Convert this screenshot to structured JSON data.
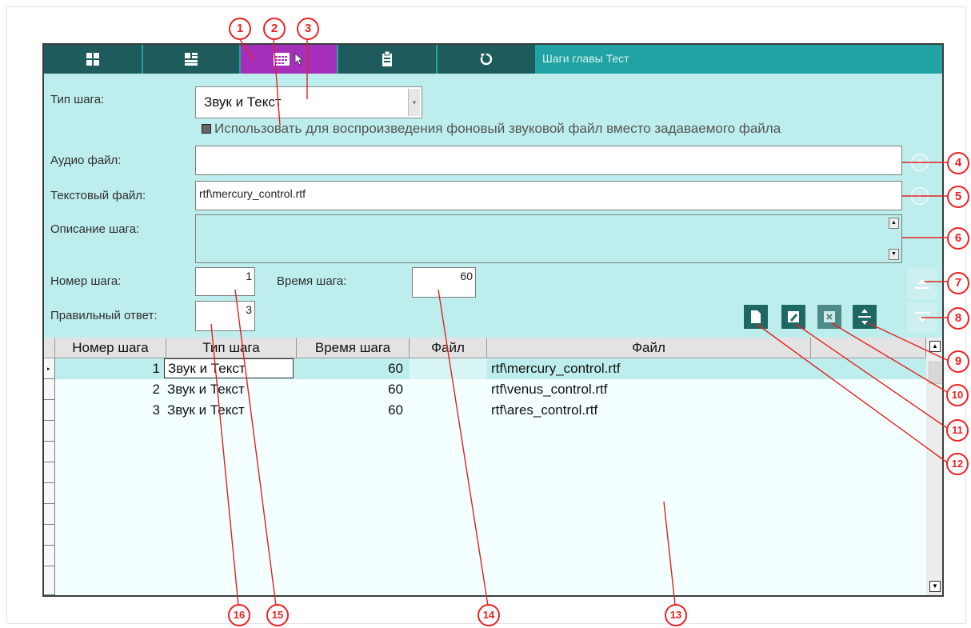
{
  "toolbar": {
    "title": "Шаги главы Тест",
    "buttons": [
      "grid-icon",
      "list-icon",
      "calendar-icon",
      "clipboard-icon",
      "refresh-icon"
    ],
    "active_index": 2
  },
  "form": {
    "step_type_label": "Тип шага:",
    "step_type_value": "Звук и Текст",
    "checkbox_label": "Использовать для воспроизведения фоновый звуковой файл вместо задаваемого файла",
    "checkbox_checked": true,
    "audio_label": "Аудио файл:",
    "audio_value": "",
    "text_label": "Текстовый файл:",
    "text_value": "rtf\\mercury_control.rtf",
    "desc_label": "Описание шага:",
    "desc_value": "",
    "step_num_label": "Номер шага:",
    "step_num_value": "1",
    "step_time_label": "Время шага:",
    "step_time_value": "60",
    "answer_label": "Правильный ответ:",
    "answer_value": "3"
  },
  "grid": {
    "columns": [
      "Номер шага",
      "Тип шага",
      "Время шага",
      "Файл",
      "Файл"
    ],
    "rows": [
      {
        "num": "1",
        "type": "Звук и Текст",
        "time": "60",
        "file1": "",
        "file2": "rtf\\mercury_control.rtf"
      },
      {
        "num": "2",
        "type": "Звук и Текст",
        "time": "60",
        "file1": "",
        "file2": "rtf\\venus_control.rtf"
      },
      {
        "num": "3",
        "type": "Звук и Текст",
        "time": "60",
        "file1": "",
        "file2": "rtf\\ares_control.rtf"
      }
    ],
    "selected_row": 0
  },
  "callouts": [
    "1",
    "2",
    "3",
    "4",
    "5",
    "6",
    "7",
    "8",
    "9",
    "10",
    "11",
    "12",
    "13",
    "14",
    "15",
    "16"
  ],
  "colors": {
    "toolbar": "#22a3a3",
    "toolbar_button": "#1d5b5c",
    "toolbar_active": "#a52fba",
    "form_bg": "#bdeeed",
    "callout": "#e22222"
  }
}
